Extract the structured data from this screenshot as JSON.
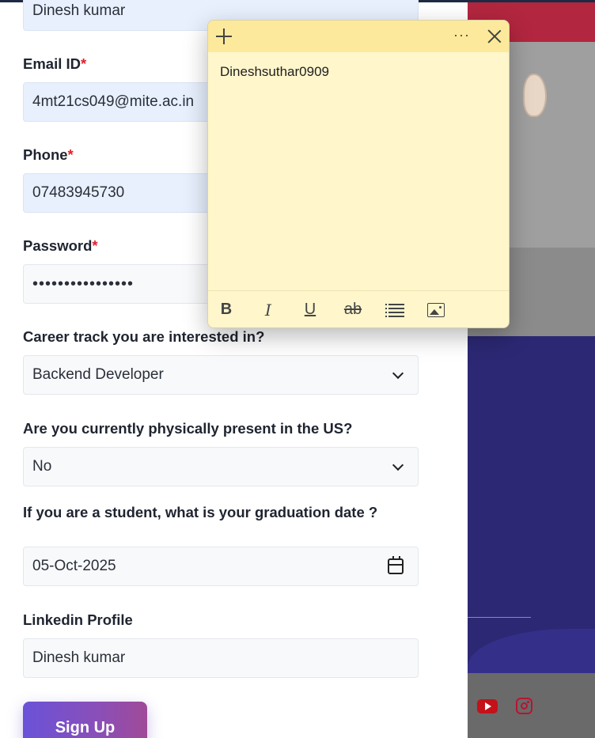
{
  "form": {
    "name_value": "Dinesh kumar",
    "email_label": "Email ID",
    "email_value": "4mt21cs049@mite.ac.in",
    "phone_label": "Phone",
    "phone_value": "07483945730",
    "password_label": "Password",
    "password_value": "••••••••••••••••",
    "required_mark": "*",
    "career_label": "Career track you are interested in?",
    "career_value": "Backend Developer",
    "us_label": "Are you currently physically present in the US?",
    "us_value": "No",
    "grad_label": "If you are a student, what is your graduation date ?",
    "grad_value": "05-Oct-2025",
    "linkedin_label": "Linkedin Profile",
    "linkedin_value": "Dinesh kumar",
    "signup_label": "Sign Up"
  },
  "sticky_note": {
    "text": "Dineshsuthar0909",
    "more_label": "···",
    "bold_label": "B",
    "italic_label": "I",
    "underline_label": "U",
    "strike_label": "ab"
  },
  "colors": {
    "accent_gradient_start": "#6a52d9",
    "accent_gradient_end": "#a04a98",
    "required": "#e0202a",
    "autofill_bg": "#e8f0fe",
    "sticky_bg": "#fff6cc",
    "sticky_header": "#fde99b",
    "panel_indigo": "#2c2873",
    "panel_crimson": "#b3263f"
  },
  "icons": [
    "plus-icon",
    "more-icon",
    "close-icon",
    "bold-icon",
    "italic-icon",
    "underline-icon",
    "strikethrough-icon",
    "list-icon",
    "image-icon",
    "chevron-down-icon",
    "calendar-icon",
    "youtube-icon",
    "instagram-icon"
  ]
}
